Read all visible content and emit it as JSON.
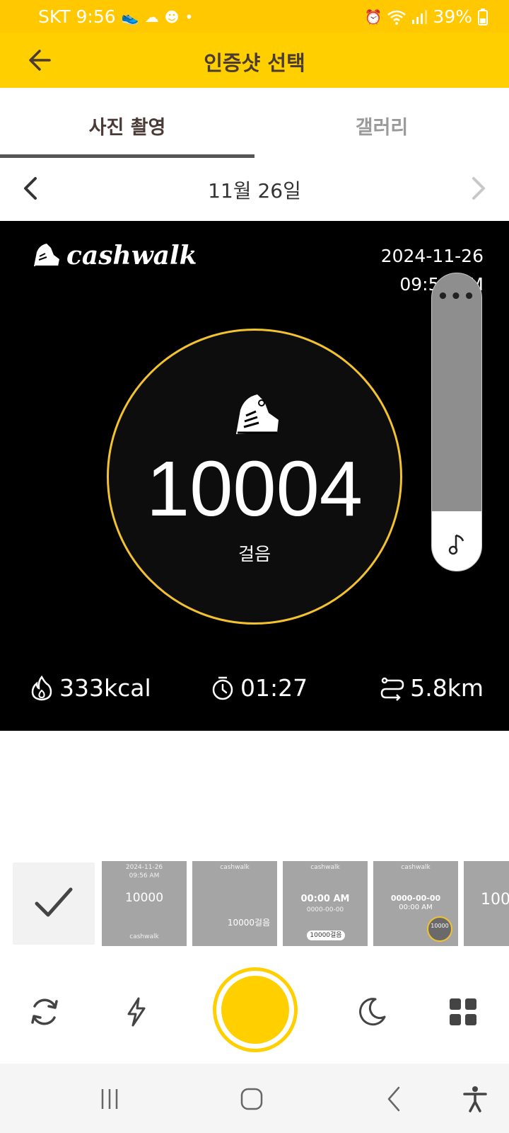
{
  "status_bar": {
    "carrier_time": "SKT 9:56",
    "battery": "39%",
    "icons": [
      "shoe-icon",
      "cloud-icon",
      "character-icon",
      "dot-icon",
      "alarm-icon",
      "wifi-icon",
      "signal-icon",
      "battery-icon"
    ]
  },
  "appbar": {
    "title": "인증샷 선택"
  },
  "tabs": [
    {
      "label": "사진 촬영",
      "active": true
    },
    {
      "label": "갤러리",
      "active": false
    }
  ],
  "date_nav": {
    "date": "11월 26일"
  },
  "preview": {
    "logo_text": "cashwalk",
    "date": "2024-11-26",
    "time": "09:56 AM",
    "steps": "10004",
    "steps_unit": "걸음",
    "kcal": "333kcal",
    "duration": "01:27",
    "distance": "5.8km",
    "music_slider_more": "•••"
  },
  "thumbnails": [
    {
      "lines": [
        "2024-11-26",
        "09:56 AM",
        "10000",
        "cashwalk"
      ]
    },
    {
      "lines": [
        "cashwalk",
        "10000걸음"
      ]
    },
    {
      "lines": [
        "cashwalk",
        "00:00 AM",
        "0000-00-00",
        "10000걸음"
      ]
    },
    {
      "lines": [
        "cashwalk",
        "0000-00-00",
        "00:00 AM",
        "10000"
      ]
    },
    {
      "lines": [
        "100"
      ]
    }
  ],
  "colors": {
    "brand_yellow": "#FFCF00",
    "ring": "#F2C230",
    "text_dark": "#4a3b36"
  }
}
